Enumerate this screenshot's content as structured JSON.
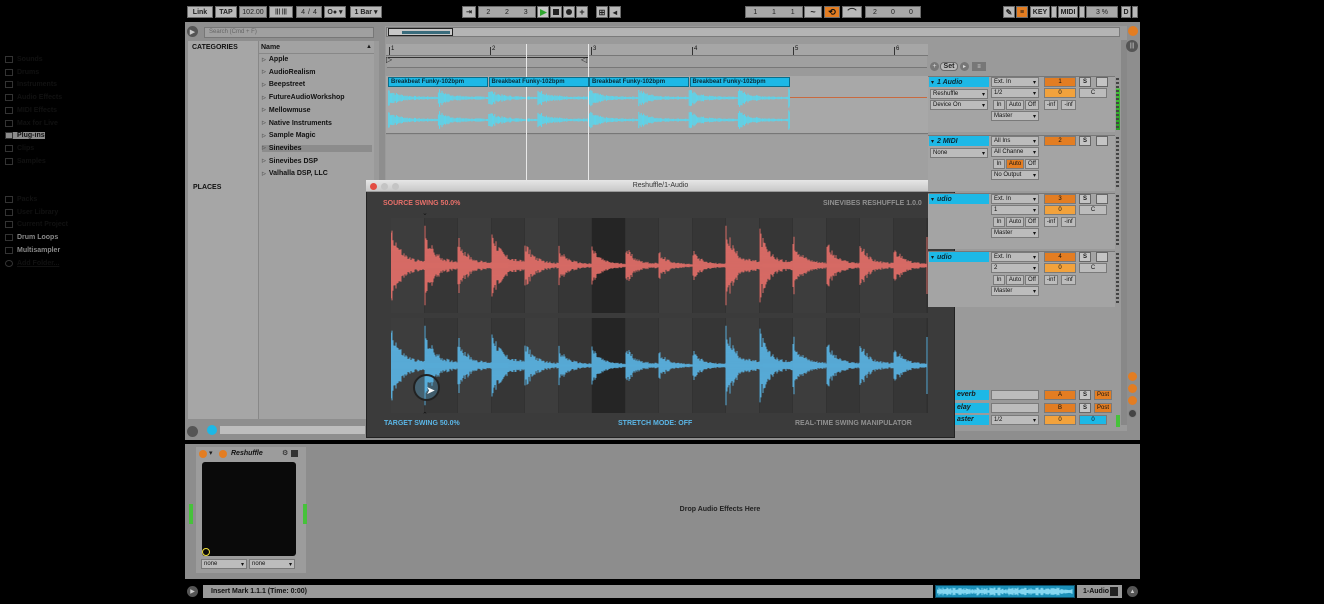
{
  "transport": {
    "link": "Link",
    "tap": "TAP",
    "tempo": "102.00",
    "metronome_dots": "||| |||",
    "sig_num": "4",
    "sig_slash": "/",
    "sig_den": "4",
    "dots": "O● ▾",
    "quantize": "1 Bar ▾",
    "follow": "⇥",
    "pos1": "2",
    "pos2": "2",
    "pos3": "3",
    "loop_start1": "1",
    "loop_start2": "1",
    "loop_start3": "1",
    "punch_len1": "2",
    "punch_len2": "0",
    "punch_len3": "0",
    "key": "KEY",
    "midi": "MIDI",
    "cpu": "3 %",
    "d": "D"
  },
  "browser": {
    "search_placeholder": "Search (Cmd + F)",
    "categories_title": "CATEGORIES",
    "categories": [
      "Sounds",
      "Drums",
      "Instruments",
      "Audio Effects",
      "MIDI Effects",
      "Max for Live",
      "Plug-ins",
      "Clips",
      "Samples"
    ],
    "places_title": "PLACES",
    "places": [
      "Packs",
      "User Library",
      "Current Project",
      "Drum Loops",
      "Multisampler",
      "Add Folder..."
    ],
    "name_header": "Name",
    "names": [
      "Apple",
      "AudioRealism",
      "Beepstreet",
      "FutureAudioWorkshop",
      "Mellowmuse",
      "Native Instruments",
      "Sample Magic",
      "Sinevibes",
      "Sinevibes DSP",
      "Valhalla DSP, LLC"
    ]
  },
  "arrangement": {
    "ruler": [
      "1",
      "2",
      "3",
      "4",
      "5",
      "6"
    ],
    "clips": [
      "Breakbeat Funky-102bpm",
      "Breakbeat Funky-102bpm",
      "Breakbeat Funky-102bpm",
      "Breakbeat Funky-102bpm"
    ],
    "set_label": "Set"
  },
  "tracks": [
    {
      "name": "1 Audio",
      "device": "Reshuffle",
      "device2": "Device On",
      "input": "Ext. In",
      "input2": "1/2",
      "in": "In",
      "auto": "Auto",
      "off": "Off",
      "out": "Master",
      "num": "1",
      "s": "S",
      "vol": "0",
      "pan": "C",
      "inf1": "-inf",
      "inf2": "-inf"
    },
    {
      "name": "2 MIDI",
      "device": "None",
      "input": "All Ins",
      "input2": "All Channe",
      "in": "In",
      "auto": "Auto",
      "off": "Off",
      "out": "No Output",
      "num": "2",
      "s": "S"
    },
    {
      "name": "udio",
      "input": "Ext. In",
      "input2": "1",
      "in": "In",
      "auto": "Auto",
      "off": "Off",
      "out": "Master",
      "num": "3",
      "s": "S",
      "vol": "0",
      "pan": "C",
      "inf1": "-inf",
      "inf2": "-inf"
    },
    {
      "name": "udio",
      "input": "Ext. In",
      "input2": "2",
      "in": "In",
      "auto": "Auto",
      "off": "Off",
      "out": "Master",
      "num": "4",
      "s": "S",
      "vol": "0",
      "pan": "C",
      "inf1": "-inf",
      "inf2": "-inf"
    }
  ],
  "returns": [
    {
      "name": "everb",
      "letter": "A",
      "s": "S",
      "post": "Post"
    },
    {
      "name": "elay",
      "letter": "B",
      "s": "S",
      "post": "Post"
    },
    {
      "name": "aster",
      "io": "1/2",
      "vol": "0",
      "vol2": "0"
    }
  ],
  "plugin": {
    "window_title": "Reshuffle/1-Audio",
    "source_swing": "SOURCE SWING 50.0%",
    "brand": "SINEVIBES RESHUFFLE 1.0.0",
    "target_swing": "TARGET SWING 50.0%",
    "stretch_mode": "STRETCH MODE: OFF",
    "tagline": "REAL-TIME SWING MANIPULATOR",
    "colors": {
      "source": "#e8706a",
      "target": "#5bb7e8",
      "bg": "#3a3a3a",
      "text_red": "#e8706a",
      "text_blue": "#5bb7e8"
    }
  },
  "device_chain": {
    "device_name": "Reshuffle",
    "select1": "none",
    "select2": "none",
    "drop_text": "Drop Audio Effects Here"
  },
  "status": {
    "message": "Insert Mark 1.1.1 (Time: 0:00)",
    "track": "1-Audio"
  }
}
